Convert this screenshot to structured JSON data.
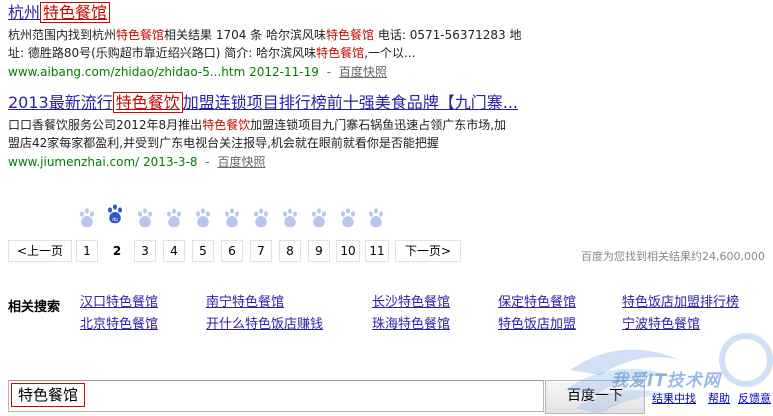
{
  "results": [
    {
      "title_pre": "杭州",
      "title_kw": "特色餐馆",
      "title_post": "",
      "abstract": [
        {
          "t": "杭州范围内找到杭州",
          "h": false
        },
        {
          "t": "特色餐馆",
          "h": true
        },
        {
          "t": "相关结果 1704 条 哈尔滨风味",
          "h": false
        },
        {
          "t": "特色餐馆",
          "h": true
        },
        {
          "t": " 电话: 0571-56371283 地",
          "h": false
        }
      ],
      "abstract2": [
        {
          "t": "址: 德胜路80号(乐购超市靠近绍兴路口) 简介: 哈尔滨风味",
          "h": false
        },
        {
          "t": "特色餐馆",
          "h": true
        },
        {
          "t": ",一个以...",
          "h": false
        }
      ],
      "url": "www.aibang.com/zhidao/zhidao-5...htm 2012-11-19",
      "snapshot": "百度快照"
    },
    {
      "title_pre": "2013最新流行",
      "title_kw": "特色餐饮",
      "title_post": "加盟连锁项目排行榜前十强美食品牌【九门寨...",
      "abstract": [
        {
          "t": "口口香餐饮服务公司2012年8月推出",
          "h": false
        },
        {
          "t": "特色餐饮",
          "h": true
        },
        {
          "t": "加盟连锁项目九门寨石锅鱼迅速占领广东市场,加",
          "h": false
        }
      ],
      "abstract2": [
        {
          "t": "盟店42家每家都盈利,并受到广东电视台关注报导,机会就在眼前就看你是否能把握",
          "h": false
        }
      ],
      "url": "www.jiumenzhai.com/ 2013-3-8",
      "snapshot": "百度快照"
    }
  ],
  "pager": {
    "prev": "<上一页",
    "pages": [
      "1",
      "2",
      "3",
      "4",
      "5",
      "6",
      "7",
      "8",
      "9",
      "10",
      "11"
    ],
    "current": "2",
    "next": "下一页>"
  },
  "result_count": "百度为您找到相关结果约24,600,000",
  "related": {
    "title": "相关搜索",
    "row1": [
      "汉口特色餐馆",
      "南宁特色餐馆",
      "长沙特色餐馆",
      "保定特色餐馆",
      "特色饭店加盟排行榜"
    ],
    "row2": [
      "北京特色餐馆",
      "开什么特色饭店赚钱",
      "珠海特色餐馆",
      "特色饭店加盟",
      "宁波特色餐馆"
    ]
  },
  "search": {
    "value": "特色餐馆",
    "button": "百度一下",
    "links": [
      "结果中找",
      "帮助",
      "反馈意"
    ]
  },
  "watermark_text": "我爱IT技术网",
  "colors": {
    "title_link": "#2a1fa8",
    "highlight": "#c60a00",
    "url_green": "#008000",
    "paw_blue": "#2f57c9",
    "paw_inactive": "#b9c6ee"
  },
  "icons": [
    "baidu-paw-icon"
  ]
}
